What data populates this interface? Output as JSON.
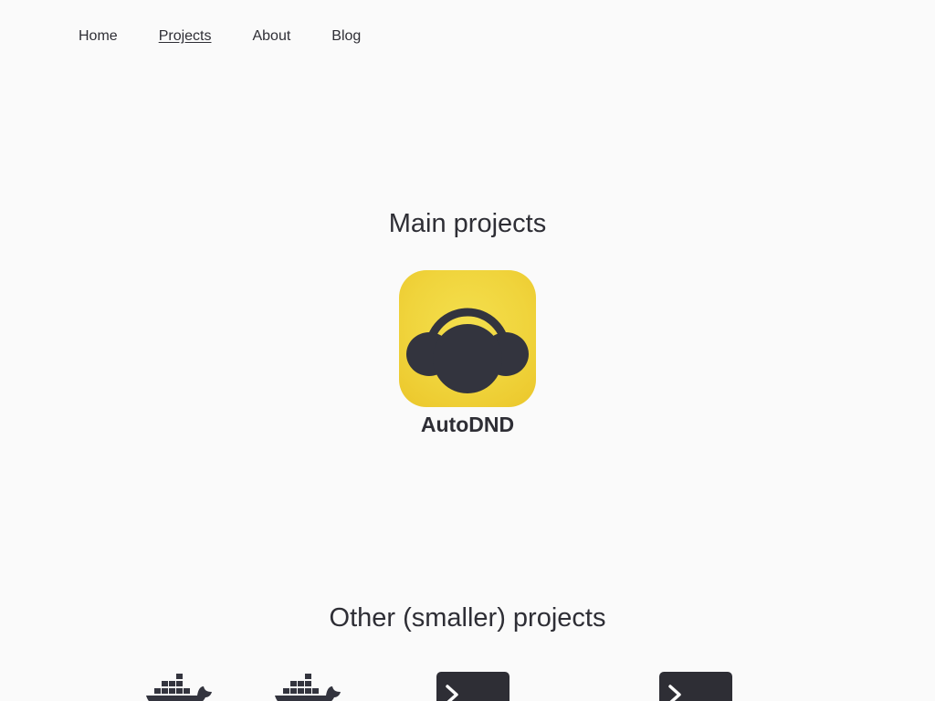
{
  "nav": {
    "items": [
      {
        "label": "Home"
      },
      {
        "label": "Projects",
        "active": true
      },
      {
        "label": "About"
      },
      {
        "label": "Blog"
      }
    ]
  },
  "main_section": {
    "title": "Main projects",
    "projects": [
      {
        "name": "AutoDND",
        "icon": "headphones-icon",
        "icon_bg": "#f0d43c",
        "icon_fg": "#33343e"
      }
    ]
  },
  "other_section": {
    "title": "Other (smaller) projects",
    "projects": [
      {
        "icon": "docker-whale-icon"
      },
      {
        "icon": "docker-whale-icon"
      },
      {
        "icon": "terminal-icon"
      },
      {
        "icon": "terminal-icon"
      }
    ]
  },
  "colors": {
    "background": "#fafafa",
    "text": "#2e2e35",
    "accent_yellow": "#f0d43c"
  }
}
